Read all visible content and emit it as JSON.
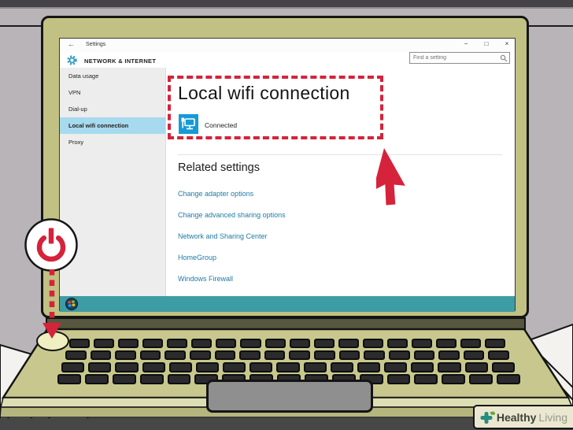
{
  "window": {
    "titlebar": {
      "back": "←",
      "title": "Settings",
      "minimize": "−",
      "maximize": "□",
      "close": "×"
    },
    "header": {
      "section": "NETWORK & INTERNET",
      "search_placeholder": "Find a setting"
    },
    "sidebar": {
      "items": [
        {
          "label": "Data usage",
          "active": false
        },
        {
          "label": "VPN",
          "active": false
        },
        {
          "label": "Dial-up",
          "active": false
        },
        {
          "label": "Local wifi connection",
          "active": true
        },
        {
          "label": "Proxy",
          "active": false
        }
      ]
    },
    "main": {
      "title": "Local wifi connection",
      "status": "Connected",
      "related_heading": "Related settings",
      "links": [
        "Change adapter options",
        "Change advanced sharing options",
        "Network and Sharing Center",
        "HomeGroup",
        "Windows Firewall"
      ]
    }
  },
  "branding": {
    "bold": "Healthy",
    "light": "Living"
  },
  "colors": {
    "annotation_red": "#d5233b",
    "taskbar_teal": "#3e9da4",
    "sidebar_highlight": "#a7daee",
    "link_blue": "#1f7aa3",
    "ethernet_icon_blue": "#169ad6",
    "laptop_khaki": "#c1c183",
    "brand_green": "#2b8b7f",
    "leaf_green": "#63a83e"
  }
}
